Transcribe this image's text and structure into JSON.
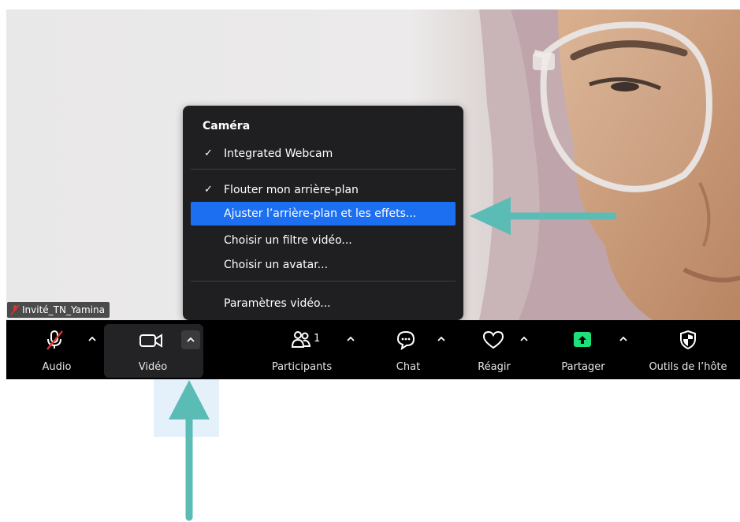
{
  "participant": {
    "name": "Invité_TN_Yamina"
  },
  "menu": {
    "heading": "Caméra",
    "items": [
      {
        "label": "Integrated Webcam",
        "checked": true
      },
      {
        "label": "Flouter mon arrière-plan",
        "checked": true
      },
      {
        "label": "Ajuster l’arrière-plan et les effets...",
        "checked": false,
        "highlighted": true
      },
      {
        "label": "Choisir un filtre vidéo...",
        "checked": false
      },
      {
        "label": "Choisir un avatar...",
        "checked": false
      },
      {
        "label": "Paramètres vidéo...",
        "checked": false
      }
    ],
    "check_glyph": "✓"
  },
  "toolbar": {
    "audio_label": "Audio",
    "video_label": "Vidéo",
    "participants_label": "Participants",
    "participants_count": "1",
    "chat_label": "Chat",
    "react_label": "Réagir",
    "share_label": "Partager",
    "host_tools_label": "Outils de l’hôte"
  },
  "colors": {
    "menu_bg": "#1f1f21",
    "menu_highlight": "#1d6ff2",
    "toolbar_bg": "#000000",
    "share_green": "#1ee07a",
    "annotation_arrow": "#5bbcb5",
    "muted_red": "#e0332e"
  },
  "icons": {
    "audio": "microphone-muted-icon",
    "video": "video-camera-icon",
    "participants": "participants-icon",
    "chat": "chat-bubble-icon",
    "react": "heart-icon",
    "share": "share-screen-icon",
    "host_tools": "shield-icon",
    "caret": "chevron-up-icon"
  }
}
